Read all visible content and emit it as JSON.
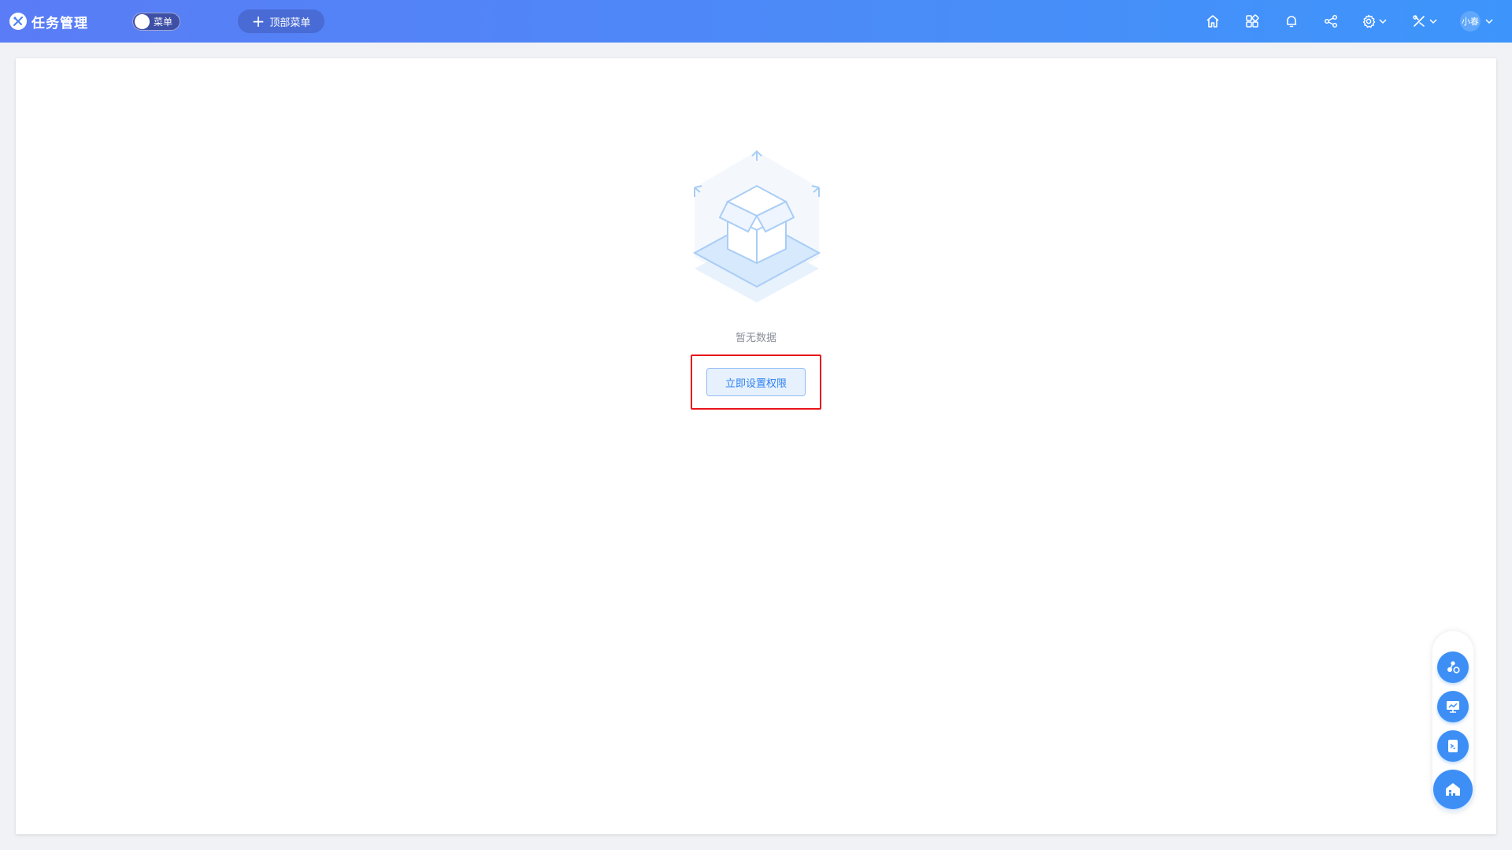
{
  "header": {
    "app_title": "任务管理",
    "menu_toggle_label": "菜单",
    "top_menu_label": "顶部菜单",
    "user_name": "小春",
    "icons": [
      "home-icon",
      "apps-grid-icon",
      "bell-icon",
      "share-icon",
      "gear-icon",
      "tools-icon",
      "chevron-down-icon"
    ]
  },
  "main": {
    "empty_text": "暂无数据",
    "set_permission_label": "立即设置权限"
  },
  "float_dock": {
    "icons": [
      "workflow-gear-icon",
      "screen-chart-icon",
      "terminal-doc-icon",
      "home-building-icon"
    ]
  },
  "colors": {
    "header_start": "#5a7cf6",
    "header_end": "#3d95fb",
    "accent": "#2f82f0",
    "highlight": "#e8141c"
  }
}
